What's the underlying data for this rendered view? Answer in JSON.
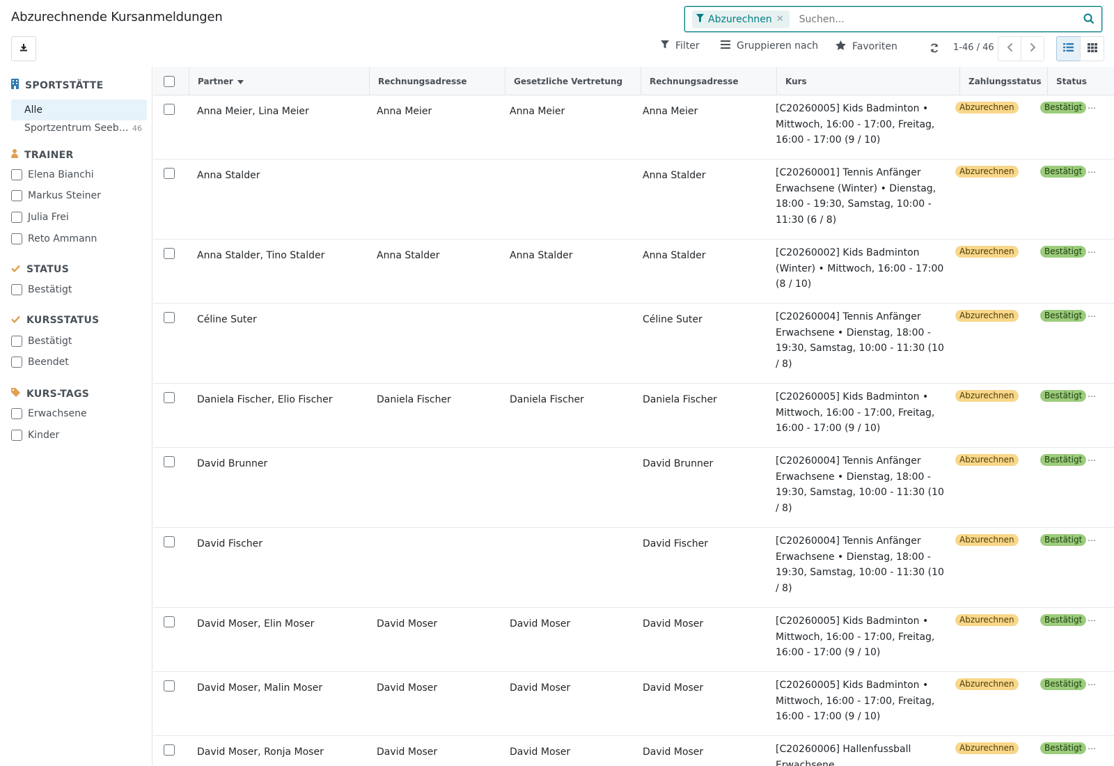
{
  "header": {
    "title": "Abzurechnende Kursanmeldungen",
    "export_icon": "download-icon",
    "search": {
      "facet_label": "Abzurechnen",
      "facet_icon": "filter-icon",
      "placeholder": "Suchen...",
      "search_icon": "search-icon"
    },
    "filter_label": "Filter",
    "groupby_label": "Gruppieren nach",
    "favorites_label": "Favoriten",
    "pager": "1-46 / 46"
  },
  "sidebar": {
    "sportstaette": {
      "title": "SPORTSTÄTTE",
      "all_label": "Alle",
      "items": [
        {
          "label": "Sportzentrum Seeb…",
          "count": "46"
        }
      ]
    },
    "trainer": {
      "title": "TRAINER",
      "items": [
        "Elena Bianchi",
        "Markus Steiner",
        "Julia Frei",
        "Reto Ammann"
      ]
    },
    "status": {
      "title": "STATUS",
      "items": [
        "Bestätigt"
      ]
    },
    "kursstatus": {
      "title": "KURSSTATUS",
      "items": [
        "Bestätigt",
        "Beendet"
      ]
    },
    "kurstags": {
      "title": "KURS-TAGS",
      "items": [
        "Erwachsene",
        "Kinder"
      ]
    }
  },
  "table": {
    "columns": [
      "Partner",
      "Rechnungsadresse",
      "Gesetzliche Vertretung",
      "Rechnungsadresse",
      "Kurs",
      "Zahlungsstatus",
      "Status"
    ],
    "rows": [
      {
        "partner": "Anna Meier, Lina Meier",
        "billing": "Anna Meier",
        "legal": "Anna Meier",
        "billing2": "Anna Meier",
        "course": [
          "[C20260005] Kids Badminton •",
          "Mittwoch, 16:00 - 17:00, Freitag,",
          "16:00 - 17:00 (9 / 10)"
        ],
        "payment": "Abzurechnen",
        "status": "Bestätigt"
      },
      {
        "partner": "Anna Stalder",
        "billing": "",
        "legal": "",
        "billing2": "Anna Stalder",
        "course": [
          "[C20260001] Tennis Anfänger",
          "Erwachsene (Winter) • Dienstag,",
          "18:00 - 19:30, Samstag, 10:00 -",
          "11:30 (6 / 8)"
        ],
        "payment": "Abzurechnen",
        "status": "Bestätigt"
      },
      {
        "partner": "Anna Stalder, Tino Stalder",
        "billing": "Anna Stalder",
        "legal": "Anna Stalder",
        "billing2": "Anna Stalder",
        "course": [
          "[C20260002] Kids Badminton",
          "(Winter) • Mittwoch, 16:00 - 17:00",
          "(8 / 10)"
        ],
        "payment": "Abzurechnen",
        "status": "Bestätigt"
      },
      {
        "partner": "Céline Suter",
        "billing": "",
        "legal": "",
        "billing2": "Céline Suter",
        "course": [
          "[C20260004] Tennis Anfänger",
          "Erwachsene • Dienstag, 18:00 -",
          "19:30, Samstag, 10:00 - 11:30 (10",
          "/ 8)"
        ],
        "payment": "Abzurechnen",
        "status": "Bestätigt"
      },
      {
        "partner": "Daniela Fischer, Elio Fischer",
        "billing": "Daniela Fischer",
        "legal": "Daniela Fischer",
        "billing2": "Daniela Fischer",
        "course": [
          "[C20260005] Kids Badminton •",
          "Mittwoch, 16:00 - 17:00, Freitag,",
          "16:00 - 17:00 (9 / 10)"
        ],
        "payment": "Abzurechnen",
        "status": "Bestätigt"
      },
      {
        "partner": "David Brunner",
        "billing": "",
        "legal": "",
        "billing2": "David Brunner",
        "course": [
          "[C20260004] Tennis Anfänger",
          "Erwachsene • Dienstag, 18:00 -",
          "19:30, Samstag, 10:00 - 11:30 (10",
          "/ 8)"
        ],
        "payment": "Abzurechnen",
        "status": "Bestätigt"
      },
      {
        "partner": "David Fischer",
        "billing": "",
        "legal": "",
        "billing2": "David Fischer",
        "course": [
          "[C20260004] Tennis Anfänger",
          "Erwachsene • Dienstag, 18:00 -",
          "19:30, Samstag, 10:00 - 11:30 (10",
          "/ 8)"
        ],
        "payment": "Abzurechnen",
        "status": "Bestätigt"
      },
      {
        "partner": "David Moser, Elin Moser",
        "billing": "David Moser",
        "legal": "David Moser",
        "billing2": "David Moser",
        "course": [
          "[C20260005] Kids Badminton •",
          "Mittwoch, 16:00 - 17:00, Freitag,",
          "16:00 - 17:00 (9 / 10)"
        ],
        "payment": "Abzurechnen",
        "status": "Bestätigt"
      },
      {
        "partner": "David Moser, Malin Moser",
        "billing": "David Moser",
        "legal": "David Moser",
        "billing2": "David Moser",
        "course": [
          "[C20260005] Kids Badminton •",
          "Mittwoch, 16:00 - 17:00, Freitag,",
          "16:00 - 17:00 (9 / 10)"
        ],
        "payment": "Abzurechnen",
        "status": "Bestätigt"
      },
      {
        "partner": "David Moser, Ronja Moser",
        "billing": "David Moser",
        "legal": "David Moser",
        "billing2": "David Moser",
        "course": [
          "[C20260006] Hallenfussball",
          "Erwachsene"
        ],
        "payment": "Abzurechnen",
        "status": "Bestätigt"
      }
    ]
  },
  "colors": {
    "accent": "#017e84",
    "payment_badge": "#f8d78a",
    "status_badge": "#9ccc7c"
  }
}
